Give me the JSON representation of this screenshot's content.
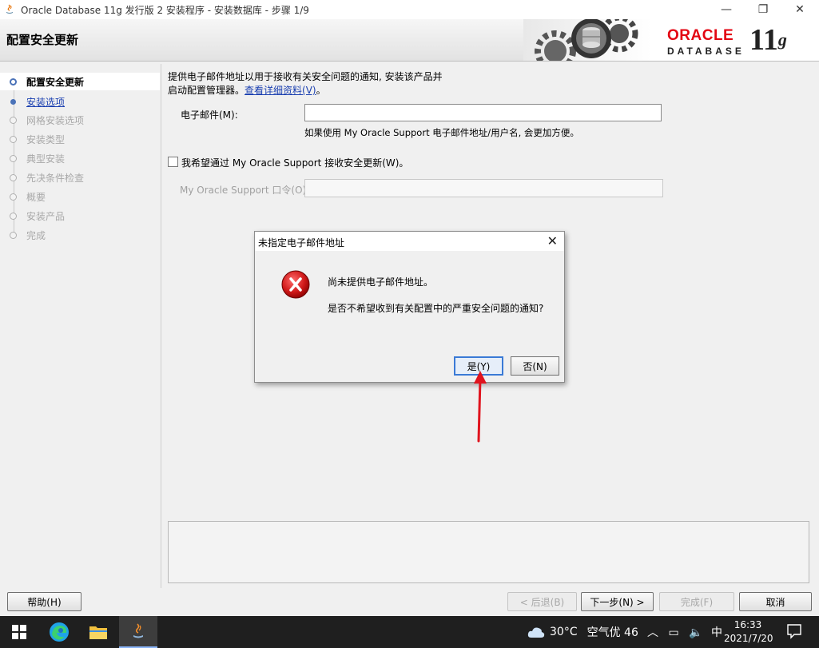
{
  "window": {
    "title": "Oracle Database 11g 发行版 2 安装程序 - 安装数据库 - 步骤 1/9",
    "minimize": "—",
    "restore": "❐",
    "close": "✕"
  },
  "header": {
    "step_title": "配置安全更新",
    "logo_oracle": "ORACLE",
    "logo_database": "DATABASE",
    "logo_version": "11",
    "logo_version_suffix": "g"
  },
  "nav": {
    "items": [
      {
        "label": "配置安全更新",
        "state": "active"
      },
      {
        "label": "安装选项",
        "state": "link"
      },
      {
        "label": "网格安装选项",
        "state": "disabled"
      },
      {
        "label": "安装类型",
        "state": "disabled"
      },
      {
        "label": "典型安装",
        "state": "disabled"
      },
      {
        "label": "先决条件检查",
        "state": "disabled"
      },
      {
        "label": "概要",
        "state": "disabled"
      },
      {
        "label": "安装产品",
        "state": "disabled"
      },
      {
        "label": "完成",
        "state": "disabled"
      }
    ]
  },
  "content": {
    "intro_line1": "提供电子邮件地址以用于接收有关安全问题的通知, 安装该产品并",
    "intro_line2": "启动配置管理器。",
    "details_link": "查看详细资料(V)",
    "intro_end": "。",
    "email_label": "电子邮件(M):",
    "email_value": "",
    "email_hint": "如果使用 My Oracle Support 电子邮件地址/用户名, 会更加方便。",
    "checkbox_label": "我希望通过 My Oracle Support 接收安全更新(W)。",
    "checkbox_checked": false,
    "password_label": "My Oracle Support 口令(O):",
    "password_value": ""
  },
  "buttons": {
    "help": "帮助(H)",
    "back": "< 后退(B)",
    "next": "下一步(N) >",
    "finish": "完成(F)",
    "cancel": "取消"
  },
  "dialog": {
    "title": "未指定电子邮件地址",
    "close": "✕",
    "message1": "尚未提供电子邮件地址。",
    "message2": "是否不希望收到有关配置中的严重安全问题的通知?",
    "yes": "是(Y)",
    "no": "否(N)"
  },
  "taskbar": {
    "weather_temp": "30°C",
    "weather_air": "空气优 46",
    "ime": "中",
    "time": "16:33",
    "date": "2021/7/20"
  },
  "colors": {
    "link": "#1a3fb0",
    "oracle_red": "#e30613",
    "annotation_arrow": "#e0141e"
  }
}
